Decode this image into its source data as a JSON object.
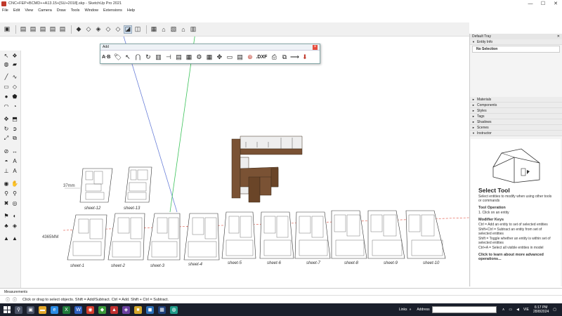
{
  "window": {
    "title": "CNC+FEP+BCMD++A13.15+[SU+2018].skp - SketchUp Pro 2021",
    "controls": [
      "—",
      "☐",
      "✕"
    ]
  },
  "menu": [
    "File",
    "Edit",
    "View",
    "Camera",
    "Draw",
    "Tools",
    "Window",
    "Extensions",
    "Help"
  ],
  "add_window": {
    "title": "Add",
    "icons": [
      "A·B",
      "tag-icon",
      "cursor-icon",
      "arc-icon",
      "rotate-icon",
      "panel-a-icon",
      "panel-b-icon",
      "panel-c-icon",
      "panel-d-icon",
      "gear-icon",
      "table-icon",
      "move-icon",
      "rect-icon",
      "grid-icon",
      "add-icon",
      "DXF",
      "printer-icon",
      "frame-icon",
      "line-icon",
      "arrow-down-icon"
    ],
    "dxf_label": ".DXF",
    "ab_label": "A·B"
  },
  "viewport": {
    "dim_small": "37mm",
    "dim_large": "4365MM",
    "sheets_top": [
      "sheet-12",
      "sheet-13"
    ],
    "sheets_bottom": [
      "sheet-1",
      "sheet-2",
      "sheet-3",
      "sheet-4",
      "sheet-5",
      "sheet-6",
      "sheet-7",
      "sheet-8",
      "sheet-9",
      "sheet-10"
    ]
  },
  "tray": {
    "title": "Default Tray",
    "entity_info": "Entity Info",
    "no_selection": "No Selection",
    "panels": [
      "Materials",
      "Components",
      "Styles",
      "Tags",
      "Shadows",
      "Scenes",
      "Instructor"
    ]
  },
  "instructor": {
    "tool_name": "Select Tool",
    "desc": "Select entities to modify when using other tools or commands",
    "op_heading": "Tool Operation",
    "op_text": "1. Click on an entity",
    "mod_heading": "Modifier Keys",
    "mods": [
      "Ctrl = Add an entity to set of selected entities",
      "Shift+Ctrl = Subtract an entity from set of selected entities",
      "Shift = Toggle whether an entity is within set of selected entities",
      "Ctrl+A = Select all visible entities in model"
    ],
    "more": "Click to learn about more advanced operations..."
  },
  "measurements": {
    "label": "Measurements"
  },
  "status": {
    "text": "Click or drag to select objects. Shift = Add/Subtract. Ctrl = Add. Shift + Ctrl = Subtract."
  },
  "taskbar": {
    "links": "Links",
    "address": "Address",
    "lang": "VIE",
    "time": "6:17 PM",
    "date": "28/8/2024"
  },
  "colors": {
    "blue_axis": "#6a7fd8",
    "green_axis": "#3cc35a",
    "red_axis": "#e04a3a",
    "wood": "#7a5234",
    "taskbar": "#1a1f2b"
  }
}
